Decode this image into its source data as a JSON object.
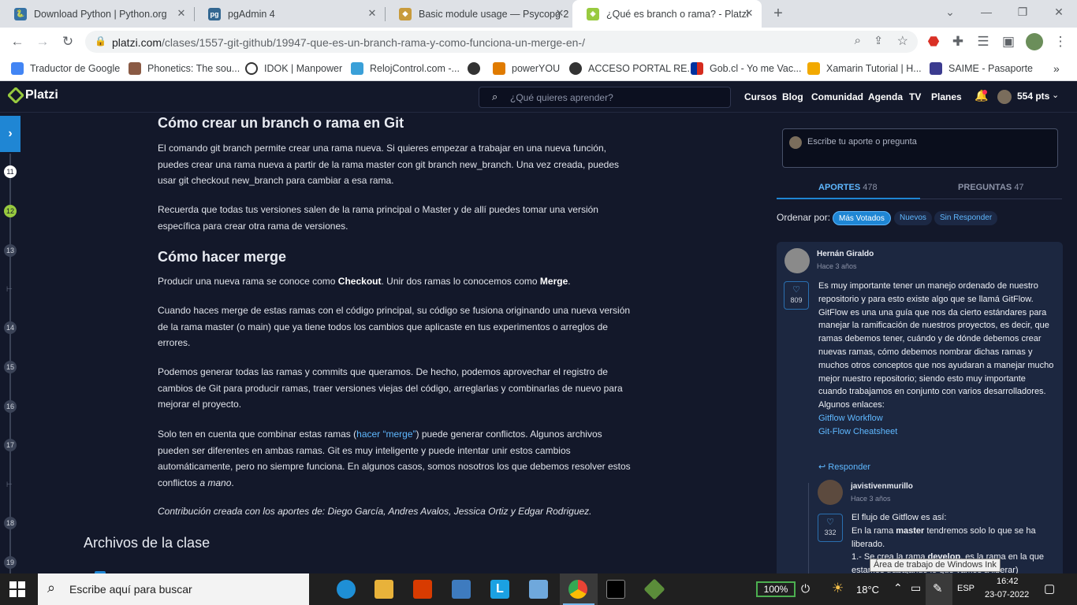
{
  "tabs": [
    {
      "title": "Download Python | Python.org",
      "icon": "python-icon",
      "color": "#3572A5"
    },
    {
      "title": "pgAdmin 4",
      "icon": "pgadmin-icon",
      "color": "#336791"
    },
    {
      "title": "Basic module usage — Psycopg 2",
      "icon": "psycopg-icon",
      "color": "#c89b3c"
    },
    {
      "title": "¿Qué es branch o rama? - Platzi",
      "icon": "platzi-icon",
      "color": "#98ca3f"
    }
  ],
  "window_controls": {
    "chevron": "⌄",
    "minimize": "—",
    "restore": "❐",
    "close": "✕"
  },
  "url": {
    "host": "platzi.com",
    "path": "/clases/1557-git-github/19947-que-es-un-branch-rama-y-como-funciona-un-merge-en-/"
  },
  "bookmarks": [
    {
      "label": "Traductor de Google",
      "color": "#4285f4"
    },
    {
      "label": "Phonetics: The sou...",
      "color": "#8a5a44"
    },
    {
      "label": "IDOK | Manpower",
      "color": "#333333"
    },
    {
      "label": "RelojControl.com -...",
      "color": "#3aa0d8"
    },
    {
      "label": "",
      "color": "#333333"
    },
    {
      "label": "powerYOU",
      "color": "#e07b00"
    },
    {
      "label": "ACCESO PORTAL RE...",
      "color": "#333333"
    },
    {
      "label": "Gob.cl - Yo me Vac...",
      "color": "#0033a0"
    },
    {
      "label": "Xamarin Tutorial | H...",
      "color": "#f2a900"
    },
    {
      "label": "SAIME - Pasaporte",
      "color": "#3b3b8f"
    }
  ],
  "header": {
    "logo": "Platzi",
    "search_placeholder": "¿Qué quieres aprender?",
    "nav": [
      "Cursos",
      "Blog",
      "Comunidad",
      "Agenda",
      "TV",
      "Planes"
    ],
    "points": "554 pts"
  },
  "rail": {
    "toggle": "›",
    "items": [
      "11",
      "12",
      "13",
      "",
      "14",
      "15",
      "16",
      "17",
      "",
      "18",
      "19"
    ],
    "current": "12"
  },
  "article": {
    "h_branch": "Cómo crear un branch o rama en Git",
    "p1": "El comando git branch permite crear una rama nueva. Si quieres empezar a trabajar en una nueva función, puedes crear una rama nueva a partir de la rama master con git branch new_branch. Una vez creada, puedes usar git checkout new_branch para cambiar a esa rama.",
    "p2": "Recuerda que todas tus versiones salen de la rama principal o Master y de allí puedes tomar una versión específica para crear otra rama de versiones.",
    "h_merge": "Cómo hacer merge",
    "p3_a": "Producir una nueva rama se conoce como ",
    "p3_b": "Checkout",
    "p3_c": ". Unir dos ramas lo conocemos como ",
    "p3_d": "Merge",
    "p3_e": ".",
    "p4": "Cuando haces merge de estas ramas con el código principal, su código se fusiona originando una nueva versión de la rama master (o main) que ya tiene todos los cambios que aplicaste en tus experimentos o arreglos de errores.",
    "p5": "Podemos generar todas las ramas y commits que queramos. De hecho, podemos aprovechar el registro de cambios de Git para producir ramas, traer versiones viejas del código, arreglarlas y combinarlas de nuevo para mejorar el proyecto.",
    "p6_a": "Solo ten en cuenta que combinar estas ramas (",
    "p6_link": "hacer “merge”",
    "p6_b": ") puede generar conflictos. Algunos archivos pueden ser diferentes en ambas ramas. Git es muy inteligente y puede intentar unir estos cambios automáticamente, pero no siempre funciona. En algunos casos, somos nosotros los que debemos resolver estos conflictos ",
    "p6_em": "a mano",
    "p6_c": ".",
    "contrib": "Contribución creada con los aportes de: Diego García, Andres Avalos, Jessica Ortiz y Edgar Rodriguez.",
    "h_files": "Archivos de la clase"
  },
  "discussion": {
    "ask_placeholder": "Escribe tu aporte o pregunta",
    "tab_aportes": "APORTES",
    "aportes_count": "478",
    "tab_preguntas": "PREGUNTAS",
    "preguntas_count": "47",
    "order_label": "Ordenar por:",
    "filters": [
      "Más Votados",
      "Nuevos",
      "Sin Responder"
    ],
    "comment": {
      "author": "Hernán Giraldo",
      "time": "Hace 3 años",
      "votes": "809",
      "body": "Es muy importante tener un manejo ordenado de nuestro repositorio y para esto existe algo que se llamá GitFlow. GitFlow es una una guía que nos da cierto estándares para manejar la ramificación de nuestros proyectos, es decir, que ramas debemos tener, cuándo y de dónde debemos crear nuevas ramas, cómo debemos nombrar dichas ramas y muchos otros conceptos que nos ayudaran a manejar mucho mejor nuestro repositorio; siendo esto muy importante cuando trabajamos en conjunto con varios desarrolladores.",
      "links_label": "Algunos enlaces:",
      "link1": "Gitflow Workflow",
      "link2": "Git-Flow Cheatsheet",
      "reply": "Responder"
    },
    "reply": {
      "author": "javistivenmurillo",
      "time": "Hace 3 años",
      "votes": "332",
      "line1": "El flujo de Gitflow es así:",
      "line2_a": "En la rama ",
      "line2_b": "master",
      "line2_c": " tendremos solo lo que se ha liberado.",
      "line3_a": "1.- Se crea la rama ",
      "line3_b": "develop",
      "line3_c": ", es la rama en la que estamos trabajando lo que vamos a liberar)"
    }
  },
  "taskbar": {
    "search_placeholder": "Escribe aquí para buscar",
    "battery": "100%",
    "temp": "18°C",
    "lang": "ESP",
    "time": "16:42",
    "date": "23-07-2022",
    "tooltip": "Área de trabajo de Windows Ink"
  }
}
